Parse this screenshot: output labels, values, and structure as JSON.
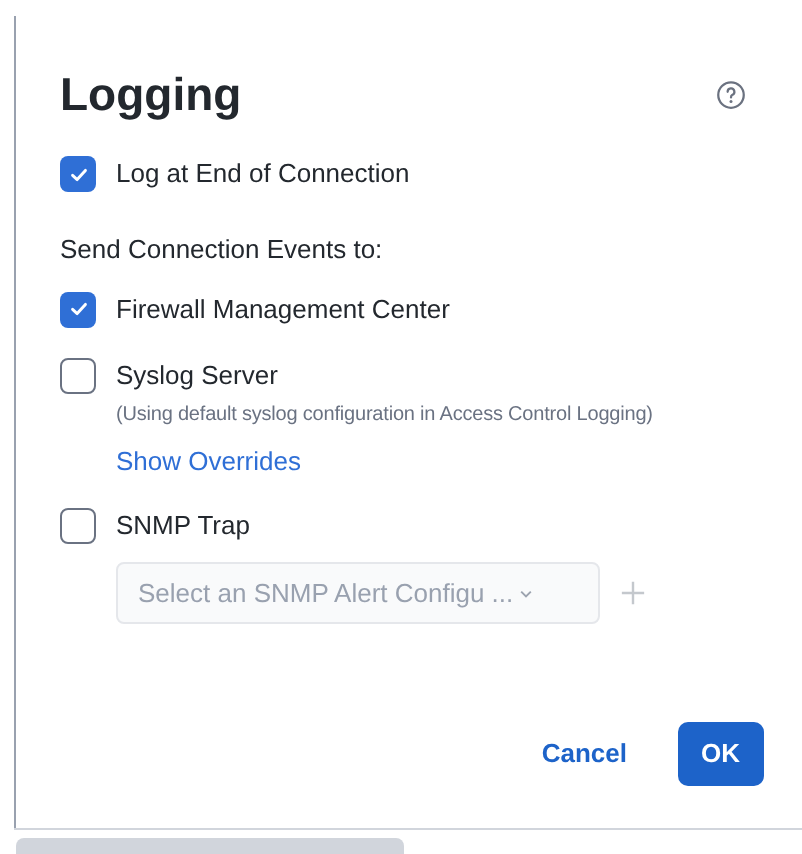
{
  "dialog": {
    "title": "Logging"
  },
  "log_end": {
    "label": "Log at End of Connection",
    "checked": true
  },
  "section_label": "Send Connection Events to:",
  "destinations": [
    {
      "kind": "plain",
      "label": "Firewall Management Center",
      "checked": true
    },
    {
      "kind": "syslog",
      "label": "Syslog Server",
      "checked": false,
      "note": "(Using default syslog configuration in Access Control Logging)",
      "link": "Show Overrides"
    },
    {
      "kind": "snmp",
      "label": "SNMP Trap",
      "checked": false,
      "select": {
        "placeholder": "Select an SNMP Alert Configu ...",
        "disabled": true
      }
    }
  ],
  "buttons": [
    {
      "kind": "secondary",
      "label": "Cancel"
    },
    {
      "kind": "primary",
      "label": "OK"
    }
  ]
}
